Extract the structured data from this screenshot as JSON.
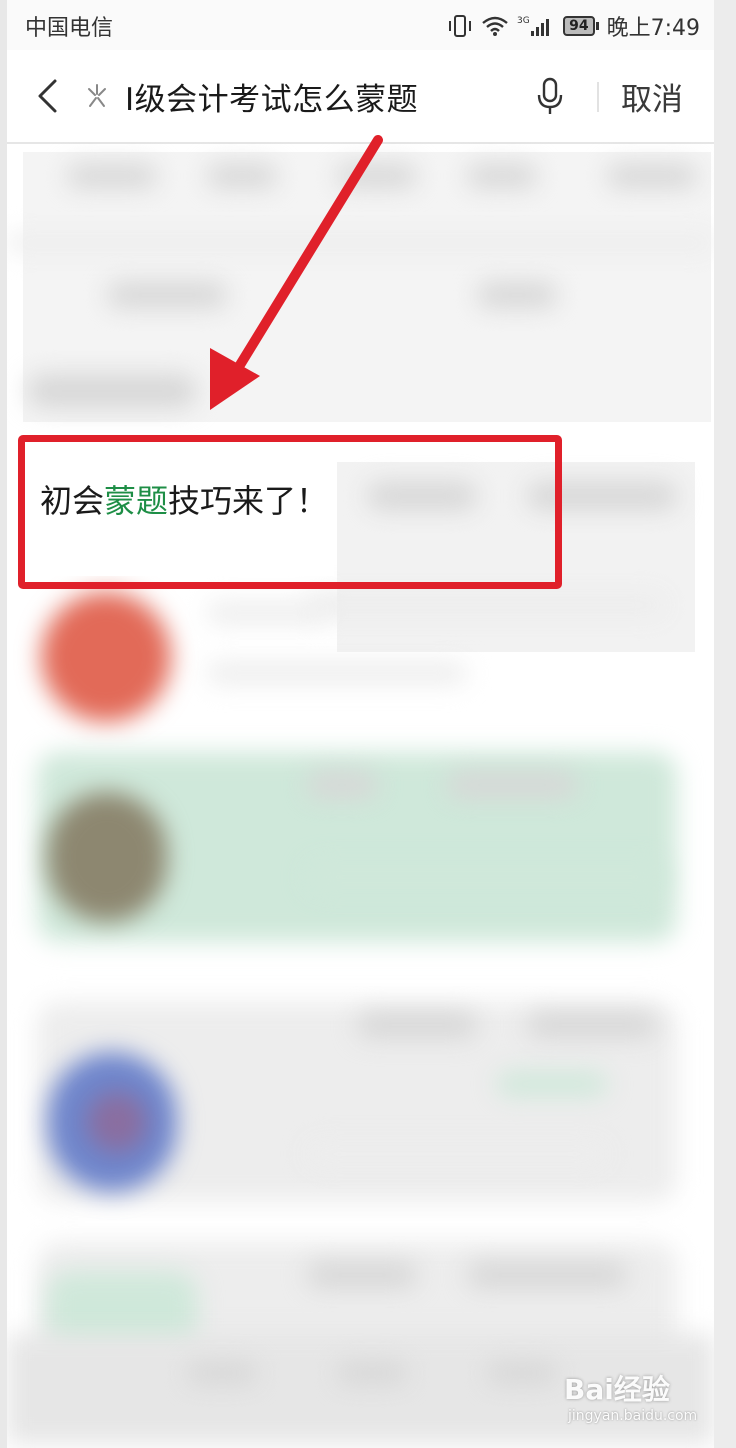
{
  "status_bar": {
    "carrier": "中国电信",
    "network_type": "3G",
    "battery_level": "94",
    "time": "晚上7:49"
  },
  "search": {
    "query": "I级会计考试怎么蒙题",
    "cancel_label": "取消"
  },
  "result": {
    "title_parts": [
      "初会",
      "蒙题",
      "技巧来了！"
    ]
  },
  "watermark": {
    "logo": "Bai经验",
    "sub": "jingyan.baidu.com"
  },
  "colors": {
    "highlight_keyword": "#1e8e46",
    "annotation_red": "#e0202a"
  }
}
